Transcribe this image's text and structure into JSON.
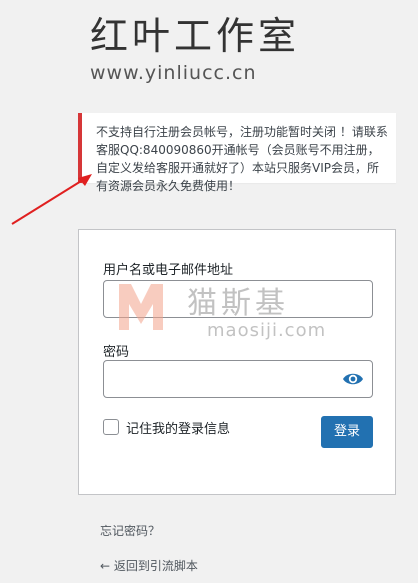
{
  "logo": {
    "title": "红叶工作室",
    "url": "www.yinliucc.cn"
  },
  "notice": {
    "text": "不支持自行注册会员帐号，注册功能暂时关闭 ！请联系客服QQ:840090860开通帐号（会员账号不用注册，自定义发给客服开通就好了）本站只服务VIP会员，所有资源会员永久免费使用！"
  },
  "form": {
    "username_label": "用户名或电子邮件地址",
    "username_value": "",
    "password_label": "密码",
    "password_value": "",
    "remember_label": "记住我的登录信息",
    "login_label": "登录"
  },
  "watermark": {
    "brand_cn": "猫斯基",
    "brand_en": "maosiji.com"
  },
  "links": {
    "lost_password": "忘记密码？",
    "back_to_site": "← 返回到引流脚本"
  },
  "colors": {
    "accent": "#2271b1",
    "error_border": "#d63638",
    "annotation_arrow": "#e02020"
  }
}
